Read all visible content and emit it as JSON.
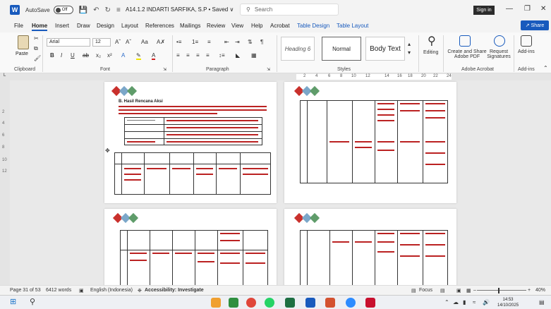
{
  "titlebar": {
    "autosave_label": "AutoSave",
    "autosave_state": "Off",
    "doc_title": "A14.1.2 INDARTI SARFIKA, S.P • Saved ∨",
    "search_placeholder": "Search",
    "signin_label": "Sign in",
    "minimize": "—",
    "restore": "❐",
    "close": "✕"
  },
  "menu": {
    "tabs": [
      "File",
      "Home",
      "Insert",
      "Draw",
      "Design",
      "Layout",
      "References",
      "Mailings",
      "Review",
      "View",
      "Help",
      "Acrobat",
      "Table Design",
      "Table Layout"
    ],
    "active": "Home",
    "share_label": "Share"
  },
  "ribbon": {
    "clipboard": {
      "paste_label": "Paste",
      "group_label": "Clipboard"
    },
    "font": {
      "font_name": "Arial",
      "font_size": "12",
      "group_label": "Font",
      "buttons": [
        "B",
        "I",
        "U",
        "ab",
        "x₂",
        "x²",
        "A",
        "A"
      ]
    },
    "paragraph": {
      "group_label": "Paragraph"
    },
    "styles": {
      "group_label": "Styles",
      "items": [
        "Heading 6",
        "Normal",
        "Body Text"
      ],
      "selected": "Normal"
    },
    "editing": {
      "label": "Editing"
    },
    "acrobat": {
      "group_label": "Adobe Acrobat",
      "create_label": "Create and Share Adobe PDF",
      "request_label": "Request Signatures"
    },
    "addins": {
      "label": "Add-ins",
      "group_label": "Add-ins"
    }
  },
  "ruler": {
    "numbers": [
      "2",
      "4",
      "6",
      "8",
      "10",
      "12",
      "14",
      "16",
      "18",
      "20",
      "22",
      "24"
    ]
  },
  "vruler": {
    "numbers": [
      "2",
      "4",
      "6",
      "8",
      "10",
      "12"
    ]
  },
  "pages": {
    "p1_heading": "B.  Hasil Rencana Aksi"
  },
  "statusbar": {
    "page": "Page 31 of 53",
    "words": "6412 words",
    "language": "English (Indonesia)",
    "accessibility": "Accessibility: Investigate",
    "focus": "Focus",
    "zoom": "40%"
  },
  "taskbar": {
    "time": "14:53",
    "date": "14/10/2025"
  },
  "colors": {
    "accent": "#185abd",
    "tracked_changes": "#b22222"
  }
}
